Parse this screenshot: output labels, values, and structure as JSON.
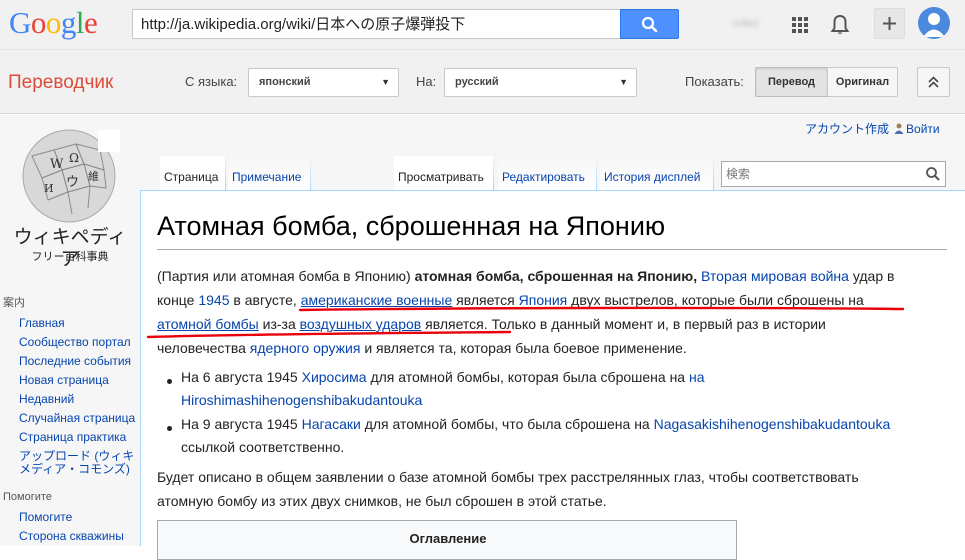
{
  "google": {
    "logo_letters": [
      "G",
      "o",
      "o",
      "g",
      "l",
      "e"
    ],
    "logo_colors": [
      "#4285f4",
      "#ea4335",
      "#fbbc05",
      "#4285f4",
      "#34a853",
      "#ea4335"
    ],
    "url": "http://ja.wikipedia.org/wiki/日本への原子爆弾投下",
    "user_blurred": "n4ko",
    "icons": [
      "search-icon",
      "apps-grid-icon",
      "bell-icon",
      "plus-icon",
      "avatar"
    ]
  },
  "translate": {
    "title": "Переводчик",
    "from_label": "С языка:",
    "from_value": "японский",
    "to_label": "На:",
    "to_value": "русский",
    "show_label": "Показать:",
    "btn_translation": "Перевод",
    "btn_original": "Оригинал"
  },
  "wiki": {
    "logo_name": "ウィキペディア",
    "logo_tagline": "フリー百科事典",
    "account_create": "アカウント作成",
    "login": "Войти",
    "tabs": {
      "page": "Страница",
      "note": "Примечание",
      "view": "Просматривать",
      "edit": "Редактировать",
      "history": "История дисплей"
    },
    "search_placeholder": "検索",
    "sidebar": {
      "heading1": "案内",
      "items1": [
        "Главная",
        "Сообщество портал",
        "Последние события",
        "Новая страница",
        "Недавний",
        "Случайная страница",
        "Страница практика",
        "アップロード (ウィキ",
        "メディア・コモンズ)"
      ],
      "heading2": "Помогите",
      "items2": [
        "Помогите",
        "Сторона скважины"
      ]
    },
    "title": "Атомная бомба, сброшенная на Японию",
    "p1": {
      "a": "(Партия или атомная бомба в Японию) ",
      "b": "атомная бомба, сброшенная на Японию,",
      "c": " ",
      "d": "Вторая мировая война",
      "e": " удар в",
      "f": "конце ",
      "g": "1945",
      "h": " в августе, ",
      "i": "американские военные",
      "j": " является ",
      "k": "Япония",
      "l": " двух выстрелов, которые были сброшены на",
      "m": "атомной бомбы",
      "n": " из-за ",
      "o": "воздушных ударов",
      "p": " является. Только в данный момент и, в первый раз в истории",
      "q": "человечества ",
      "r": "ядерного оружия",
      "s": " и является та, которая была боевое применение."
    },
    "b1": {
      "a": "На 6 августа 1945 ",
      "b": "Хиросима",
      "c": " для атомной бомбы, которая была сброшена на ",
      "d": "на",
      "e": "Hiroshimashihenogenshibakudantouka"
    },
    "b2": {
      "a": "На 9 августа 1945 ",
      "b": "Нагасаки",
      "c": " для атомной бомбы, что была сброшена на ",
      "d": "Nagasakishihenogenshibakudantouka",
      "e": "ссылкой соответственно."
    },
    "p2": {
      "line1": "Будет описано в общем заявлении о базе атомной бомбы трех расстрелянных глаз, чтобы соответствовать",
      "line2": "атомную бомбу из этих двух снимков, не был сброшен в этой статье."
    },
    "toc_title": "Оглавление"
  },
  "colors": {
    "link": "#0645ad",
    "red_annotation": "#e8000b",
    "translate_title": "#dd4b39",
    "google_blue": "#4d90fe"
  }
}
